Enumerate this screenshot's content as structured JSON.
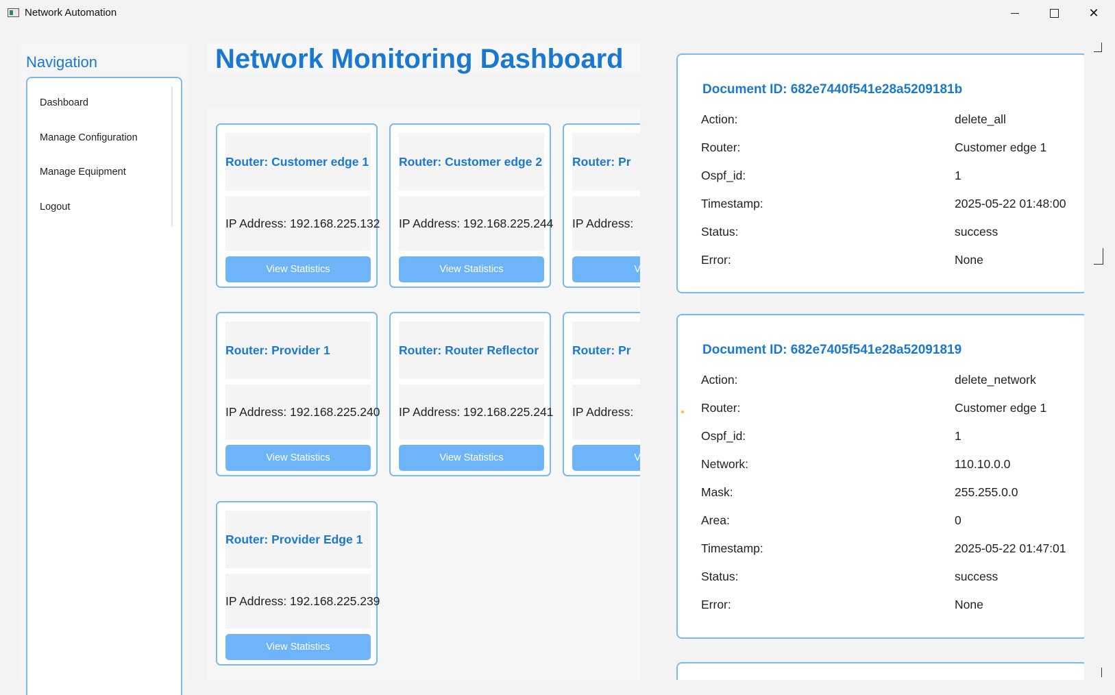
{
  "window": {
    "title": "Network Automation",
    "controls": {
      "minimize": "minimize-icon",
      "maximize": "maximize-icon",
      "close": "✕"
    }
  },
  "navigation": {
    "title": "Navigation",
    "items": [
      {
        "label": "Dashboard"
      },
      {
        "label": "Manage Configuration"
      },
      {
        "label": "Manage Equipment"
      },
      {
        "label": "Logout"
      }
    ]
  },
  "main": {
    "title": "Network Monitoring Dashboard",
    "cards": [
      {
        "title": "Router: Customer edge 1",
        "ip": "IP Address: 192.168.225.132",
        "button": "View Statistics"
      },
      {
        "title": "Router: Customer edge 2",
        "ip": "IP Address: 192.168.225.244",
        "button": "View Statistics"
      },
      {
        "title": "Router: Pr",
        "ip": "IP Address:",
        "button": "View"
      },
      {
        "title": "Router: Provider 1",
        "ip": "IP Address: 192.168.225.240",
        "button": "View Statistics"
      },
      {
        "title": "Router: Router Reflector",
        "ip": "IP Address: 192.168.225.241",
        "button": "View Statistics"
      },
      {
        "title": "Router: Pr",
        "ip": "IP Address:",
        "button": "View"
      },
      {
        "title": "Router: Provider Edge 1",
        "ip": "IP Address: 192.168.225.239",
        "button": "View Statistics"
      }
    ]
  },
  "documents": [
    {
      "title": "Document ID: 682e7440f541e28a5209181b",
      "fields": [
        {
          "key": "Action:",
          "value": "delete_all"
        },
        {
          "key": "Router:",
          "value": "Customer edge 1"
        },
        {
          "key": "Ospf_id:",
          "value": "1"
        },
        {
          "key": "Timestamp:",
          "value": "2025-05-22 01:48:00"
        },
        {
          "key": "Status:",
          "value": "success"
        },
        {
          "key": "Error:",
          "value": "None"
        }
      ]
    },
    {
      "title": "Document ID: 682e7405f541e28a52091819",
      "fields": [
        {
          "key": "Action:",
          "value": "delete_network"
        },
        {
          "key": "Router:",
          "value": "Customer edge 1"
        },
        {
          "key": "Ospf_id:",
          "value": "1"
        },
        {
          "key": "Network:",
          "value": "110.10.0.0"
        },
        {
          "key": "Mask:",
          "value": "255.255.0.0"
        },
        {
          "key": "Area:",
          "value": "0"
        },
        {
          "key": "Timestamp:",
          "value": "2025-05-22 01:47:01"
        },
        {
          "key": "Status:",
          "value": "success"
        },
        {
          "key": "Error:",
          "value": "None"
        }
      ]
    }
  ],
  "colors": {
    "accent": "#1a78d0",
    "border": "#7ab8f0",
    "button": "#6eb4f8"
  }
}
